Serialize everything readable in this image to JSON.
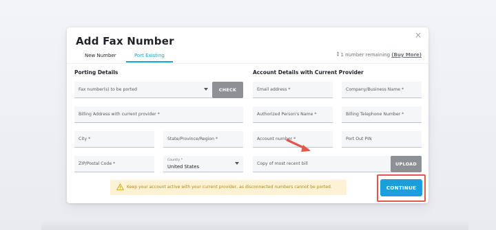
{
  "modal": {
    "title": "Add Fax Number",
    "close_glyph": "×",
    "tabs": [
      {
        "label": "New Number",
        "active": false
      },
      {
        "label": "Port Existing",
        "active": true
      }
    ],
    "remaining": {
      "icon": "fax-icon",
      "text": "1 number remaining",
      "link": "(Buy More)"
    }
  },
  "porting": {
    "title": "Porting Details",
    "fax_numbers": "Fax number(s) to be ported",
    "check_label": "CHECK",
    "billing_address": "Billing Address with current provider *",
    "city": "City *",
    "state": "State/Province/Region *",
    "zip": "ZIP/Postal Code *",
    "country_label": "Country *",
    "country_value": "United States"
  },
  "account": {
    "title": "Account Details with Current Provider",
    "email": "Email address *",
    "company": "Company/Business Name *",
    "authorized": "Authorized Person's Name *",
    "billing_phone": "Billing Telephone Number *",
    "account_number": "Account number *",
    "pin": "Port Out PIN",
    "bill": "Copy of most recent bill",
    "upload_label": "UPLOAD"
  },
  "warning": {
    "icon": "warning-icon",
    "text": "Keep your account active with your current provider, as disconnected numbers cannot be ported."
  },
  "continue_label": "CONTINUE",
  "colors": {
    "accent": "#1a9fd8",
    "highlight": "#e2564d",
    "warning_bg": "#fdf3d4",
    "warning_text": "#b98410",
    "button_gray": "#8d9196"
  }
}
